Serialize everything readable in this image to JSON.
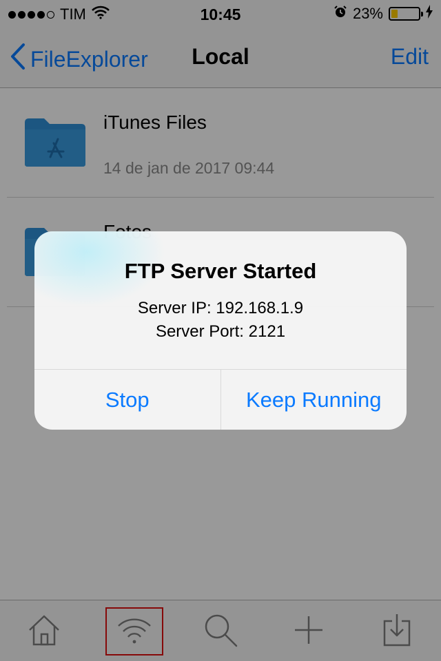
{
  "status_bar": {
    "carrier": "TIM",
    "time": "10:45",
    "battery_percent": "23%",
    "battery_level": 0.23,
    "signal_bars": 4,
    "icons": [
      "wifi-icon",
      "alarm-icon",
      "charging-bolt-icon"
    ]
  },
  "nav": {
    "back_label": "FileExplorer",
    "title": "Local",
    "edit_label": "Edit"
  },
  "files": [
    {
      "name": "iTunes Files",
      "date": "14 de jan de 2017 09:44",
      "icon": "app-store-folder-icon"
    },
    {
      "name": "Fotos",
      "date": "",
      "icon": "folder-icon"
    }
  ],
  "alert": {
    "title": "FTP Server Started",
    "line1": "Server IP: 192.168.1.9",
    "line2": "Server Port: 2121",
    "stop_label": "Stop",
    "keep_label": "Keep Running"
  },
  "tabs": [
    {
      "icon": "home-icon",
      "selected": false
    },
    {
      "icon": "wifi-icon",
      "selected": true
    },
    {
      "icon": "search-icon",
      "selected": false
    },
    {
      "icon": "add-icon",
      "selected": false
    },
    {
      "icon": "download-icon",
      "selected": false
    }
  ],
  "colors": {
    "accent": "#0a7aff",
    "folder": "#2f8fd8",
    "battery": "#ffcc00",
    "selection_outline": "#e01010"
  }
}
